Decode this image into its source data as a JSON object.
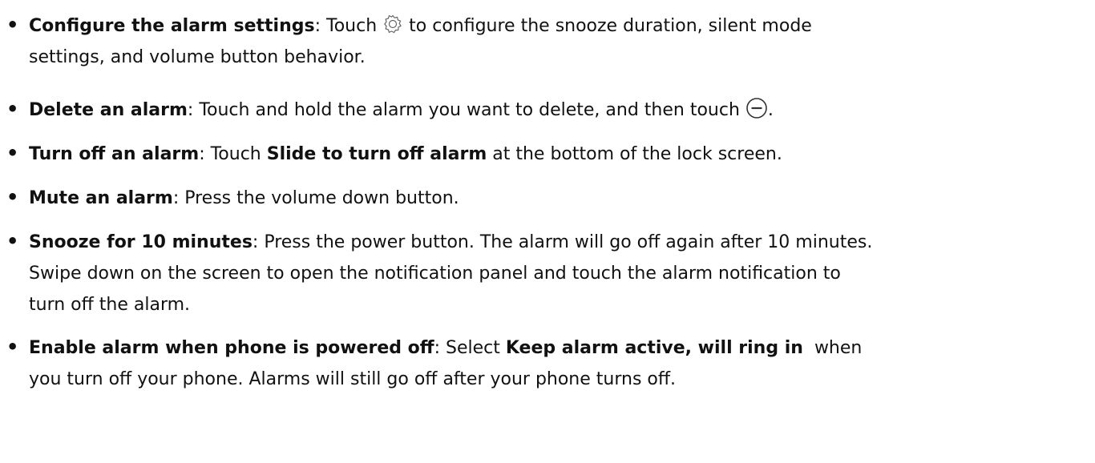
{
  "bullet_symbol": "•",
  "items": [
    {
      "title": "Configure the alarm settings",
      "sep": ": ",
      "text_before_icon": "Touch",
      "icon": "gear-icon",
      "text_after_icon": "to configure the snooze duration, silent mode",
      "line2": "settings, and volume button behavior."
    },
    {
      "title": "Delete an alarm",
      "sep": ": ",
      "text_before_icon": "Touch and hold the alarm you want to delete, and then touch",
      "icon": "minus-circle-icon",
      "text_after_icon": "."
    },
    {
      "title": "Turn off an alarm",
      "sep": ": ",
      "text1": "Touch ",
      "bold_text": "Slide to turn off alarm",
      "text2": " at the bottom of the lock screen."
    },
    {
      "title": "Mute an alarm",
      "sep": ": ",
      "text": "Press the volume down button."
    },
    {
      "title": "Snooze for 10 minutes",
      "sep": ": ",
      "line1": "Press the power button. The alarm will go off again after 10 minutes.",
      "line2": "Swipe down on the screen to open the notification panel and touch the alarm notification to",
      "line3": "turn off the alarm."
    },
    {
      "title": "Enable alarm when phone is powered off",
      "sep": ": ",
      "text1": "Select ",
      "bold_text": "Keep alarm active, will ring in",
      "text2": "  when",
      "line2": "you turn off your phone. Alarms will still go off after your phone turns off."
    }
  ]
}
